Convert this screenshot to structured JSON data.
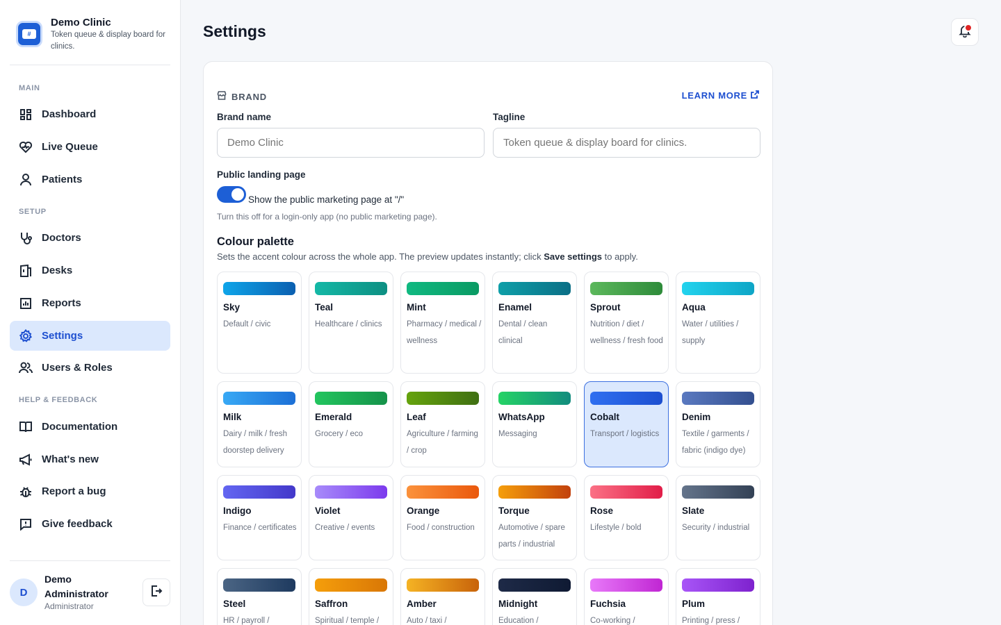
{
  "brand": {
    "name": "Demo Clinic",
    "tagline": "Token queue & display board for clinics.",
    "logo_icon": "ticket-icon"
  },
  "nav": {
    "sections": [
      "MAIN",
      "SETUP",
      "HELP & FEEDBACK"
    ],
    "items": [
      {
        "label": "Dashboard",
        "icon": "dashboard-icon"
      },
      {
        "label": "Live Queue",
        "icon": "heart-pulse-icon"
      },
      {
        "label": "Patients",
        "icon": "user-icon"
      },
      {
        "label": "Doctors",
        "icon": "stethoscope-icon"
      },
      {
        "label": "Desks",
        "icon": "desk-icon"
      },
      {
        "label": "Reports",
        "icon": "bar-chart-icon"
      },
      {
        "label": "Settings",
        "icon": "gear-icon",
        "active": true
      },
      {
        "label": "Users & Roles",
        "icon": "users-icon"
      },
      {
        "label": "Documentation",
        "icon": "book-icon"
      },
      {
        "label": "What's new",
        "icon": "megaphone-icon"
      },
      {
        "label": "Report a bug",
        "icon": "bug-icon"
      },
      {
        "label": "Give feedback",
        "icon": "message-icon"
      }
    ]
  },
  "user": {
    "initial": "D",
    "name": "Demo Administrator",
    "role": "Administrator"
  },
  "header": {
    "title": "Settings"
  },
  "settings": {
    "section": "BRAND",
    "learn_more": "LEARN MORE",
    "brand_name_label": "Brand name",
    "brand_name_placeholder": "Demo Clinic",
    "tagline_label": "Tagline",
    "tagline_placeholder": "Token queue & display board for clinics.",
    "landing_label": "Public landing page",
    "landing_toggle_on": true,
    "landing_toggle_label": "Show the public marketing page at \"/\"",
    "landing_hint": "Turn this off for a login-only app (no public marketing page).",
    "palette_title": "Colour palette",
    "palette_sub_before": "Sets the accent colour across the whole app. The preview updates instantly; click ",
    "palette_sub_bold": "Save settings",
    "palette_sub_after": " to apply."
  },
  "palettes": [
    {
      "name": "Sky",
      "desc": "Default / civic",
      "from": "#0ea5e9",
      "to": "#0b5fb0"
    },
    {
      "name": "Teal",
      "desc": "Healthcare / clinics",
      "from": "#14b8a6",
      "to": "#0d8f82"
    },
    {
      "name": "Mint",
      "desc": "Pharmacy / medical / wellness",
      "from": "#10b981",
      "to": "#0a9a63"
    },
    {
      "name": "Enamel",
      "desc": "Dental / clean clinical",
      "from": "#0e9fa8",
      "to": "#0b6f86"
    },
    {
      "name": "Sprout",
      "desc": "Nutrition / diet / wellness / fresh food",
      "from": "#5cb85c",
      "to": "#2e8b3a"
    },
    {
      "name": "Aqua",
      "desc": "Water / utilities / supply",
      "from": "#22d3ee",
      "to": "#0ea5c6"
    },
    {
      "name": "Milk",
      "desc": "Dairy / milk / fresh doorstep delivery",
      "from": "#38a9f5",
      "to": "#1c6fd6"
    },
    {
      "name": "Emerald",
      "desc": "Grocery / eco",
      "from": "#22c55e",
      "to": "#15924a"
    },
    {
      "name": "Leaf",
      "desc": "Agriculture / farming / crop",
      "from": "#65a30d",
      "to": "#3f6f12"
    },
    {
      "name": "WhatsApp",
      "desc": "Messaging",
      "from": "#25d366",
      "to": "#128c7e"
    },
    {
      "name": "Cobalt",
      "desc": "Transport / logistics",
      "from": "#2f6ff0",
      "to": "#1d4fd0",
      "selected": true
    },
    {
      "name": "Denim",
      "desc": "Textile / garments / fabric (indigo dye)",
      "from": "#5a79c0",
      "to": "#334f8f"
    },
    {
      "name": "Indigo",
      "desc": "Finance / certificates",
      "from": "#6366f1",
      "to": "#4338ca"
    },
    {
      "name": "Violet",
      "desc": "Creative / events",
      "from": "#a78bfa",
      "to": "#7c3aed"
    },
    {
      "name": "Orange",
      "desc": "Food / construction",
      "from": "#fb923c",
      "to": "#ea580c"
    },
    {
      "name": "Torque",
      "desc": "Automotive / spare parts / industrial",
      "from": "#f59e0b",
      "to": "#c2410c"
    },
    {
      "name": "Rose",
      "desc": "Lifestyle / bold",
      "from": "#fb7185",
      "to": "#e11d48"
    },
    {
      "name": "Slate",
      "desc": "Security / industrial",
      "from": "#64748b",
      "to": "#334155"
    },
    {
      "name": "Steel",
      "desc": "HR / payroll /",
      "from": "#4b6584",
      "to": "#1e3a5f"
    },
    {
      "name": "Saffron",
      "desc": "Spiritual / temple /",
      "from": "#f59e0b",
      "to": "#d97706"
    },
    {
      "name": "Amber",
      "desc": "Auto / taxi /",
      "from": "#f5b324",
      "to": "#c8630a"
    },
    {
      "name": "Midnight",
      "desc": "Education /",
      "from": "#1e2a47",
      "to": "#0f1a33"
    },
    {
      "name": "Fuchsia",
      "desc": "Co-working /",
      "from": "#e879f9",
      "to": "#c026d3"
    },
    {
      "name": "Plum",
      "desc": "Printing / press /",
      "from": "#a855f7",
      "to": "#7e22ce"
    }
  ]
}
